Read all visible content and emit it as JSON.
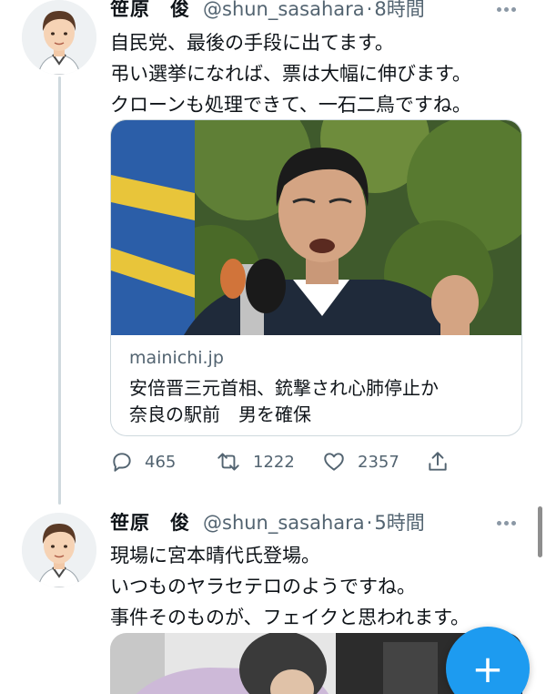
{
  "tweets": [
    {
      "name": "笹原　俊",
      "handle": "@shun_sasahara",
      "separator": "·",
      "time": "8時間",
      "lines": [
        "自民党、最後の手段に出てます。",
        "弔い選挙になれば、票は大幅に伸びます。",
        "クローンも処理できて、一石二鳥ですね。"
      ],
      "card": {
        "domain": "mainichi.jp",
        "title_lines": [
          "安倍晋三元首相、銃撃され心肺停止か",
          "奈良の駅前　男を確保"
        ]
      },
      "actions": {
        "reply_icon": "reply-icon",
        "replies": "465",
        "retweet_icon": "retweet-icon",
        "retweets": "1222",
        "like_icon": "heart-icon",
        "likes": "2357",
        "share_icon": "share-icon"
      }
    },
    {
      "name": "笹原　俊",
      "handle": "@shun_sasahara",
      "separator": "·",
      "time": "5時間",
      "lines": [
        "現場に宮本晴代氏登場。",
        "いつものヤラセテロのようですね。",
        "事件そのものが、フェイクと思われます。"
      ]
    }
  ],
  "compose": {
    "label": "+"
  },
  "colors": {
    "accent": "#1d9bf0",
    "secondary_text": "#536471",
    "border": "#cfd9de"
  }
}
